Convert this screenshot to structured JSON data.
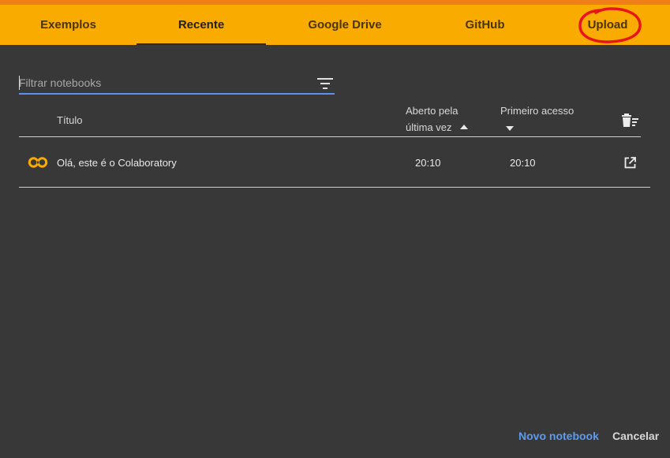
{
  "tabs": [
    {
      "label": "Exemplos",
      "active": false
    },
    {
      "label": "Recente",
      "active": true
    },
    {
      "label": "Google Drive",
      "active": false
    },
    {
      "label": "GitHub",
      "active": false
    },
    {
      "label": "Upload",
      "active": false
    }
  ],
  "filter": {
    "placeholder": "Filtrar notebooks",
    "value": ""
  },
  "table": {
    "headers": {
      "title": "Título",
      "last_opened_line1": "Aberto pela",
      "last_opened_line2": "última vez",
      "first_access": "Primeiro acesso"
    },
    "rows": [
      {
        "title": "Olá, este é o Colaboratory",
        "last_opened": "20:10",
        "first_access": "20:10"
      }
    ]
  },
  "footer": {
    "new_notebook": "Novo notebook",
    "cancel": "Cancelar"
  },
  "colors": {
    "tab_bar": "#f9ab00",
    "tab_bar_top": "#ef7d18",
    "background": "#383838",
    "link_blue": "#5b9bf0",
    "annotation_red": "#e8141c",
    "colab_logo": "#f9ab00"
  },
  "icons": {
    "filter": "filter-list-icon",
    "delete_sort": "delete-sweep-icon",
    "sort_up": "arrow-up-icon",
    "sort_down": "arrow-down-icon",
    "colab_logo": "colab-logo-icon",
    "open_external": "open-in-new-icon"
  }
}
